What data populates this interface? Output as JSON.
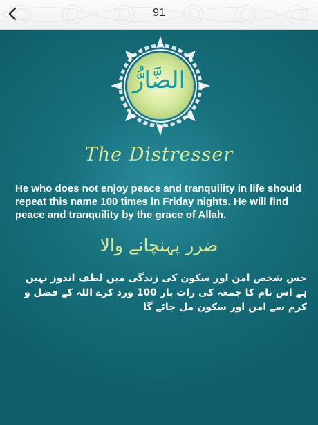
{
  "header": {
    "back_icon": "chevron-left-icon",
    "page_number": "91"
  },
  "name": {
    "arabic": "الضَّارُّ",
    "english_title": "The Distresser",
    "description": "He who does not enjoy peace and tranquility in life should repeat this name 100 times in Friday nights. He will find peace and tranquility by the grace of Allah.",
    "urdu_title": "ضرر پہنچانے والا",
    "urdu_description": "جس شخص امن اور سکون کی زندگی میں لطف اندوز نہیں ہے اس نام کا جمعہ کی رات بار 100 ورد کرے اللہ کے فضل و کرم سے امن اور سکون مل جائے گا"
  },
  "colors": {
    "background": "#17707c",
    "title_accent": "#d7e79b",
    "arabic_text": "#159aa5",
    "medallion_center": "#e9f3b4"
  }
}
